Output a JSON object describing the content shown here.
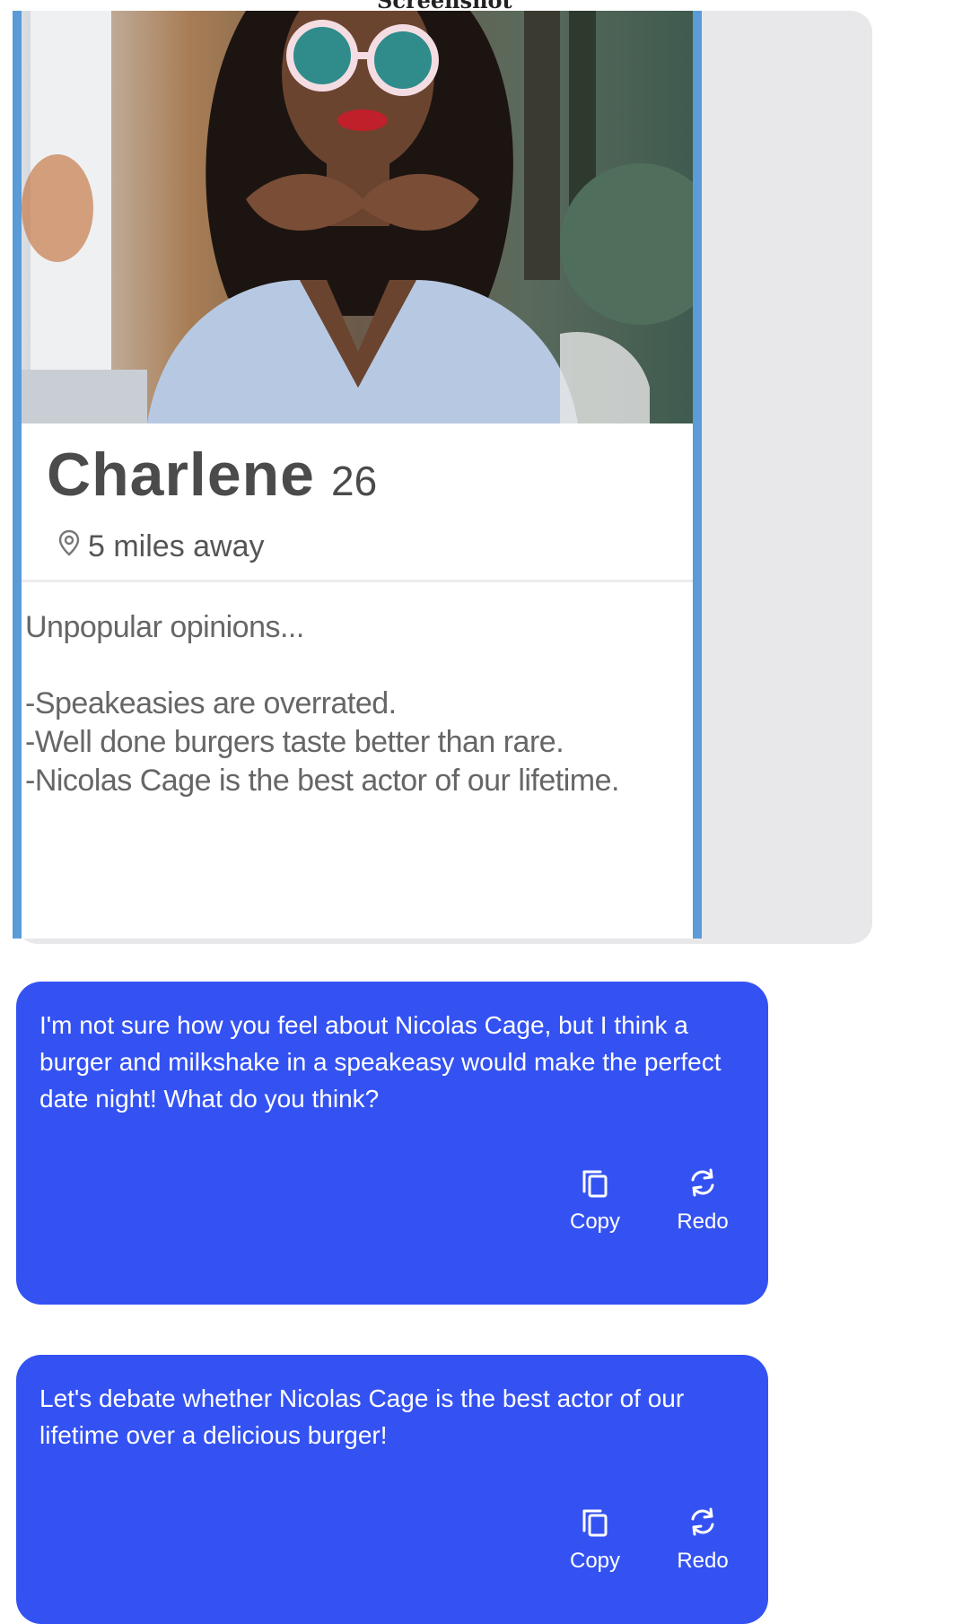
{
  "header": {
    "label": "Screenshot"
  },
  "profile": {
    "name": "Charlene",
    "age": "26",
    "distance": "5 miles away",
    "location_icon": "location-pin-icon",
    "bio_heading": "Unpopular opinions...",
    "bio_lines": [
      "-Speakeasies are overrated.",
      "-Well done burgers taste better than rare.",
      "-Nicolas Cage is the best actor of our lifetime."
    ]
  },
  "replies": [
    {
      "text": "I'm not sure how you feel about Nicolas Cage, but I think a burger and milkshake in a speakeasy would make the perfect date night! What do you think?",
      "copy_label": "Copy",
      "redo_label": "Redo"
    },
    {
      "text": "Let's debate whether Nicolas Cage is the best actor of our lifetime over a delicious burger!",
      "copy_label": "Copy",
      "redo_label": "Redo"
    }
  ],
  "colors": {
    "reply_bg": "#3452f2",
    "card_border": "#5a9bd8",
    "screenshot_bg": "#e8e8ea"
  }
}
